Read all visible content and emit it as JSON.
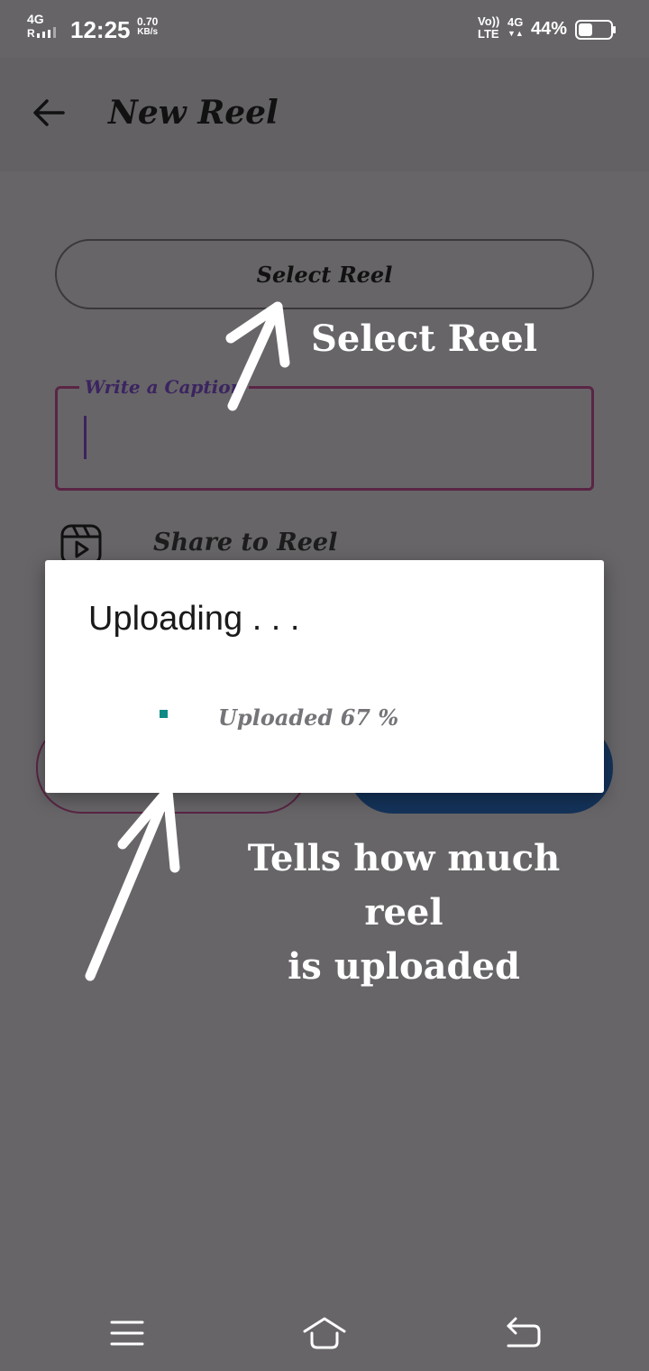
{
  "status_bar": {
    "network": "4G",
    "signal": "R",
    "time": "12:25",
    "speed_value": "0.70",
    "speed_unit": "KB/s",
    "volte": "Vo))",
    "lte": "LTE",
    "data_type": "4G",
    "battery_percent": "44%",
    "battery_level": 0.44
  },
  "header": {
    "title": "New Reel",
    "back_icon": "arrow-left-icon"
  },
  "form": {
    "select_reel_label": "Select Reel",
    "caption_label": "Write a Caption",
    "share_label": "Share to Reel",
    "share_icon": "reel-icon"
  },
  "dialog": {
    "title": "Uploading . . .",
    "progress_text": "Uploaded 67 %",
    "progress_percent": 67,
    "accent_color": "#0f8a85"
  },
  "annotations": {
    "select_note": "Select Reel",
    "upload_note_line1": "Tells how much reel",
    "upload_note_line2": "is uploaded"
  },
  "nav_bar": {
    "menu_icon": "menu-icon",
    "home_icon": "home-icon",
    "back_icon": "back-return-icon"
  }
}
